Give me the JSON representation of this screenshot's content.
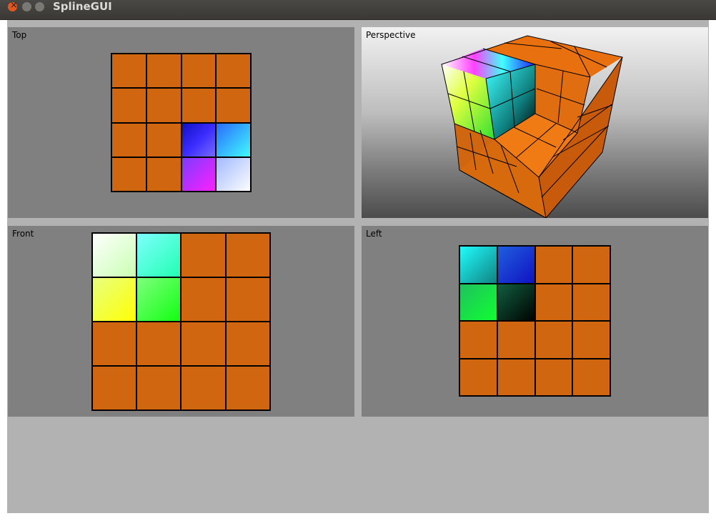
{
  "window": {
    "title": "SplineGUI"
  },
  "colors": {
    "orange": "#d06610",
    "viewport_bg": "#808080",
    "client_bg": "#b2b2b2"
  },
  "viewports": {
    "top": {
      "label": "Top"
    },
    "perspective": {
      "label": "Perspective"
    },
    "front": {
      "label": "Front"
    },
    "left": {
      "label": "Left"
    }
  }
}
